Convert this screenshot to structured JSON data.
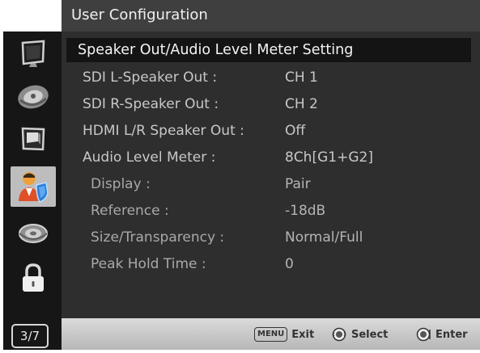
{
  "title": "User Configuration",
  "section_title": "Speaker Out/Audio Level Meter Setting",
  "sidebar": {
    "items": [
      {
        "icon": "monitor-icon"
      },
      {
        "icon": "color-wheel-icon"
      },
      {
        "icon": "display-screen-icon"
      },
      {
        "icon": "user-settings-icon",
        "active": true
      },
      {
        "icon": "gear-icon"
      },
      {
        "icon": "lock-icon"
      }
    ],
    "page_indicator": "3/7"
  },
  "settings": [
    {
      "label": "SDI L-Speaker Out :",
      "value": "CH 1"
    },
    {
      "label": "SDI R-Speaker Out :",
      "value": "CH 2"
    },
    {
      "label": "HDMI L/R Speaker Out :",
      "value": "Off"
    },
    {
      "label": "Audio Level Meter :",
      "value": "8Ch[G1+G2]"
    },
    {
      "label": "Display :",
      "value": "Pair"
    },
    {
      "label": "Reference :",
      "value": "-18dB"
    },
    {
      "label": "Size/Transparency :",
      "value": "Normal/Full"
    },
    {
      "label": "Peak Hold Time :",
      "value": "0"
    }
  ],
  "footer": {
    "menu_key": "MENU",
    "exit_label": "Exit",
    "select_label": "Select",
    "enter_label": "Enter"
  },
  "colors": {
    "background": "#2e2e2e",
    "title_bar": "#3f3f3f",
    "section_header": "#141414",
    "sidebar": "#161616",
    "active_item": "#bdbdbd",
    "text": "#c8c8c8",
    "footer": "#c9c9c9"
  }
}
